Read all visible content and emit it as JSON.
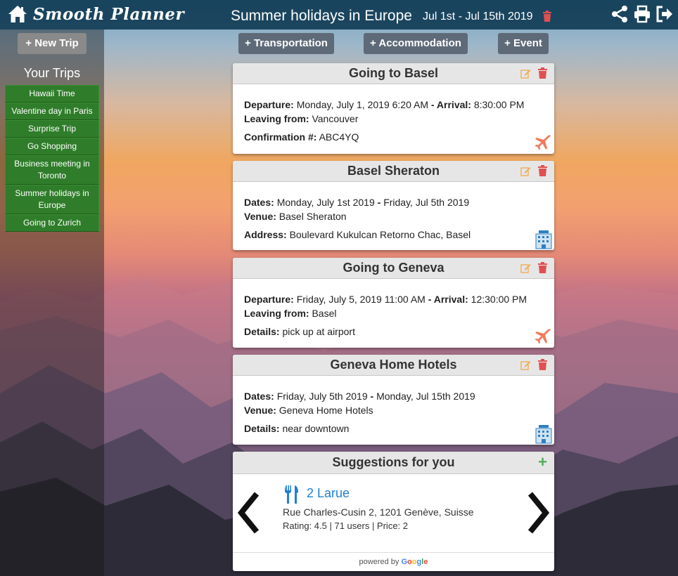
{
  "header": {
    "brand": "Smooth Planner",
    "trip_title": "Summer holidays in Europe",
    "trip_dates": "Jul 1st - Jul 15th 2019",
    "icons": [
      "home-icon",
      "trash-icon",
      "share-icon",
      "print-icon",
      "logout-icon"
    ]
  },
  "sidebar": {
    "new_trip_label": "+ New Trip",
    "heading": "Your Trips",
    "trips": [
      "Hawaii Time",
      "Valentine day in Paris",
      "Surprise Trip",
      "Go Shopping",
      "Business meeting in Toronto",
      "Summer holidays in Europe",
      "Going to Zurich"
    ]
  },
  "actions": {
    "transportation": "+ Transportation",
    "accommodation": "+ Accommodation",
    "event": "+ Event"
  },
  "cards": [
    {
      "title": "Going to Basel",
      "type": "transportation",
      "l1_label": "Departure:",
      "l1_value": "Monday, July 1, 2019 6:20 AM",
      "l1_sep": "- Arrival:",
      "l1_value2": "8:30:00 PM",
      "l2_label": "Leaving from:",
      "l2_value": "Vancouver",
      "l3_label": "Confirmation #:",
      "l3_value": "ABC4YQ",
      "icon": "airplane-icon"
    },
    {
      "title": "Basel Sheraton",
      "type": "accommodation",
      "l1_label": "Dates:",
      "l1_value": "Monday, July 1st 2019",
      "l1_sep": "-",
      "l1_value2": "Friday, Jul 5th 2019",
      "l2_label": "Venue:",
      "l2_value": "Basel Sheraton",
      "l3_label": "Address:",
      "l3_value": "Boulevard Kukulcan Retorno Chac, Basel",
      "icon": "hotel-icon"
    },
    {
      "title": "Going to Geneva",
      "type": "transportation",
      "l1_label": "Departure:",
      "l1_value": "Friday, July 5, 2019 11:00 AM",
      "l1_sep": "- Arrival:",
      "l1_value2": "12:30:00 PM",
      "l2_label": "Leaving from:",
      "l2_value": "Basel",
      "l3_label": "Details:",
      "l3_value": "pick up at airport",
      "icon": "airplane-icon"
    },
    {
      "title": "Geneva Home Hotels",
      "type": "accommodation",
      "l1_label": "Dates:",
      "l1_value": "Friday, July 5th 2019",
      "l1_sep": "-",
      "l1_value2": "Monday, Jul 15th 2019",
      "l2_label": "Venue:",
      "l2_value": "Geneva Home Hotels",
      "l3_label": "Details:",
      "l3_value": "near downtown",
      "icon": "hotel-icon"
    }
  ],
  "suggestions": {
    "heading": "Suggestions for you",
    "add_label": "+",
    "place_name": "2 Larue",
    "address": "Rue Charles-Cusin 2, 1201 Genève, Suisse",
    "rating_line": "Rating: 4.5 | 71 users | Price: 2",
    "powered_prefix": "powered by",
    "google_g": "G",
    "google_o1": "o",
    "google_o2": "o",
    "google_g2": "g",
    "google_l": "l",
    "google_e": "e",
    "icon": "fork-knife-icon"
  },
  "colors": {
    "header_bg": "#0c3750",
    "trip_green": "#2f7d2a",
    "button_gray": "#5e6a78",
    "delete_red": "#e05050",
    "edit_orange": "#f0b060",
    "link_blue": "#1f7fd4",
    "add_green": "#4caf50"
  }
}
